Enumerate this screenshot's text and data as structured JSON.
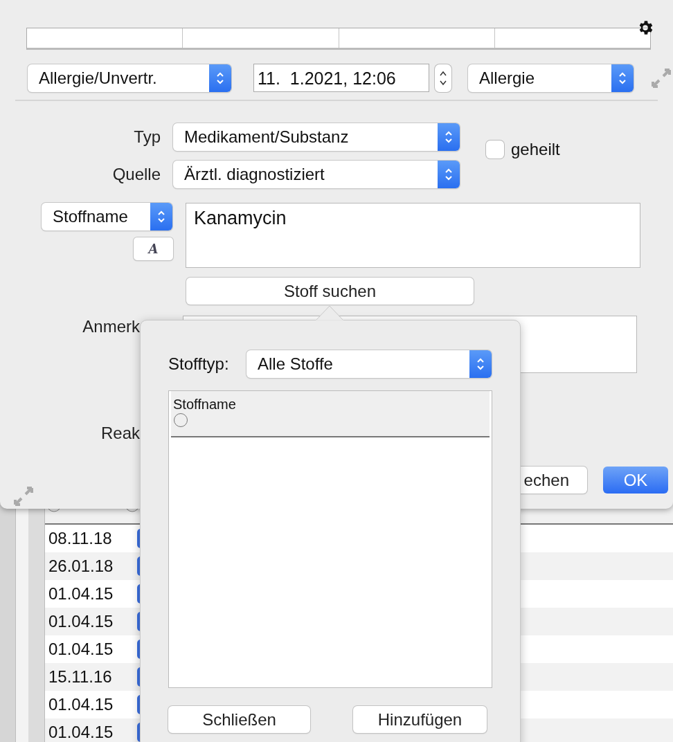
{
  "header": {
    "category": "Allergie/Unvertr.",
    "date": "11.  1.2021, 12:06",
    "kind": "Allergie"
  },
  "form": {
    "typ": {
      "label": "Typ",
      "value": "Medikament/Substanz"
    },
    "quelle": {
      "label": "Quelle",
      "value": "Ärztl. diagnostiziert"
    },
    "geheilt": {
      "label": "geheilt",
      "checked": false
    },
    "name_mode": "Stoffname",
    "font_button": "A",
    "substance": "Kanamycin",
    "search_button": "Stoff suchen",
    "anmerkung_label": "Anmerk",
    "reaktion_label": "Reak"
  },
  "buttons": [
    {
      "label": "echen",
      "kind": "default"
    },
    {
      "label": "OK",
      "kind": "primary"
    }
  ],
  "list": {
    "rows": [
      {
        "date": "08.11.18"
      },
      {
        "date": "26.01.18"
      },
      {
        "date": "01.04.15"
      },
      {
        "date": "01.04.15"
      },
      {
        "date": "01.04.15"
      },
      {
        "date": "15.11.16"
      },
      {
        "date": "01.04.15"
      },
      {
        "date": "01.04.15"
      }
    ]
  },
  "popover": {
    "type_label": "Stofftyp:",
    "type_value": "Alle Stoffe",
    "column": "Stoffname",
    "buttons": [
      "Schließen",
      "Hinzufügen"
    ]
  }
}
